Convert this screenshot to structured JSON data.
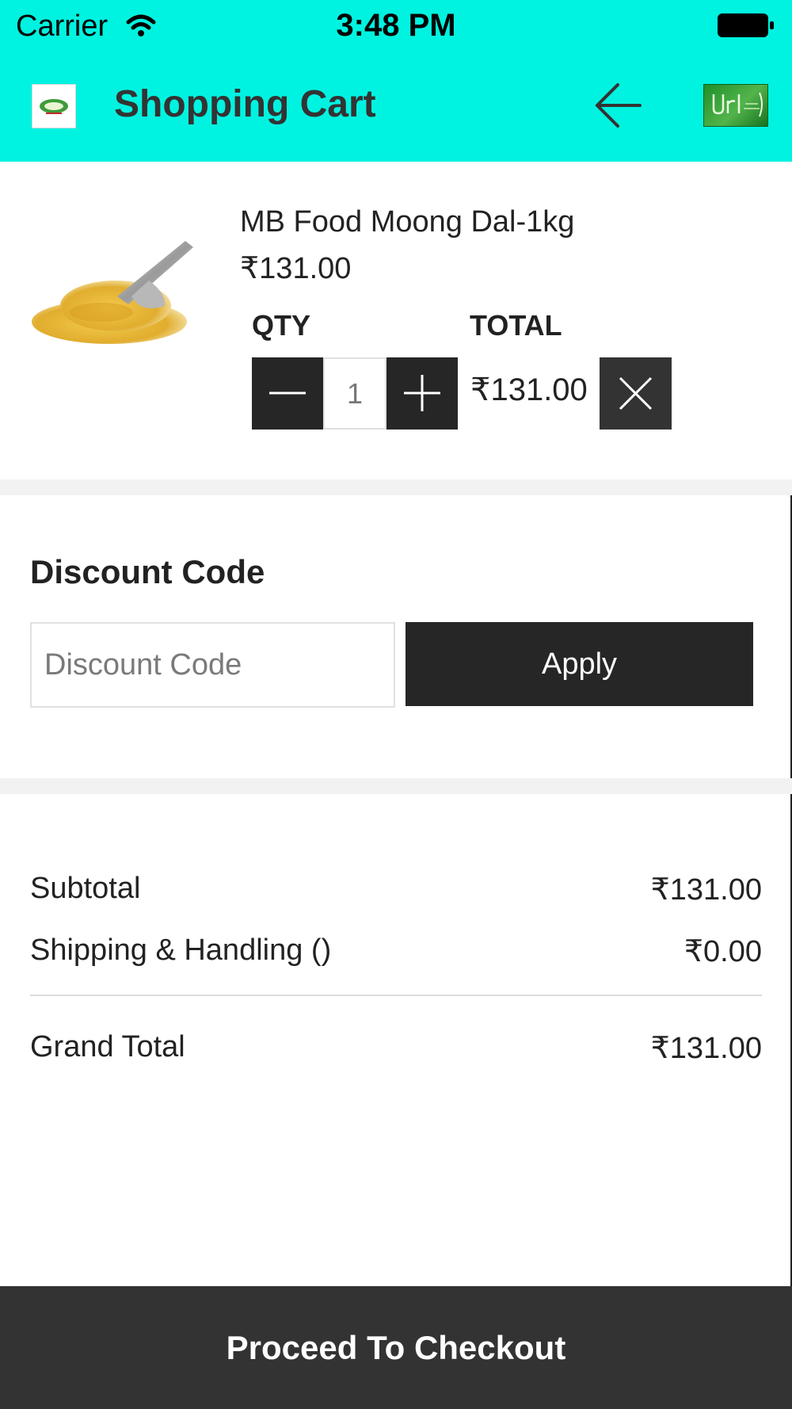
{
  "status_bar": {
    "carrier": "Carrier",
    "time": "3:48 PM"
  },
  "header": {
    "title": "Shopping Cart",
    "background_color": "#00f3e0",
    "left_icon": "store-logo-icon",
    "back_icon": "arrow-left-icon",
    "right_icon": "brand-badge-icon"
  },
  "cart_item": {
    "name": "MB Food Moong Dal-1kg",
    "price": "₹131.00",
    "qty_label": "QTY",
    "total_label": "TOTAL",
    "quantity": "1",
    "line_total": "₹131.00",
    "image_icon": "moong-dal-scoop-image"
  },
  "discount": {
    "title": "Discount Code",
    "placeholder": "Discount Code",
    "value": "",
    "apply_label": "Apply"
  },
  "totals": {
    "subtotal_label": "Subtotal",
    "subtotal_value": "₹131.00",
    "shipping_label": "Shipping & Handling ()",
    "shipping_value": "₹0.00",
    "grand_total_label": "Grand Total",
    "grand_total_value": "₹131.00"
  },
  "footer": {
    "checkout_label": "Proceed To Checkout"
  },
  "colors": {
    "dark_button": "#262626",
    "footer": "#333333"
  }
}
